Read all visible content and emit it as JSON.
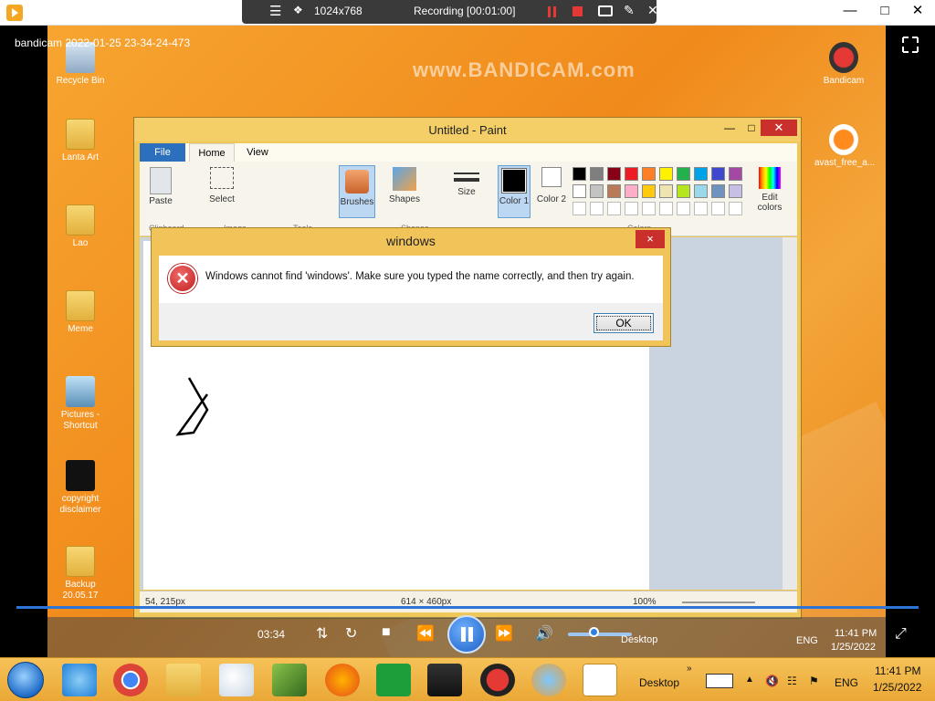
{
  "player": {
    "resolution": "1024x768",
    "recording_status": "Recording [00:01:00]",
    "video_filename": "bandicam 2022-01-25 23-34-24-473",
    "watermark": "www.BANDICAM.com",
    "current_time": "03:34",
    "playback_progress": 1.0,
    "volume_level": 0.4
  },
  "desktop": {
    "icons_left": [
      {
        "label": "Recycle Bin"
      },
      {
        "label": "Lanta Art"
      },
      {
        "label": "Lao"
      },
      {
        "label": "Meme"
      },
      {
        "label": "Pictures - Shortcut"
      },
      {
        "label": "copyright disclaimer"
      },
      {
        "label": "Backup 20.05.17"
      }
    ],
    "icons_right": [
      {
        "label": "Bandicam"
      },
      {
        "label": "avast_free_a..."
      }
    ]
  },
  "paint": {
    "title": "Untitled - Paint",
    "tabs": [
      "File",
      "Home",
      "View"
    ],
    "groups": [
      "Clipboard",
      "Image",
      "Tools",
      "Shapes",
      "Colors"
    ],
    "buttons": {
      "paste": "Paste",
      "select": "Select",
      "brushes": "Brushes",
      "shapes": "Shapes",
      "size": "Size",
      "color1": "Color 1",
      "color2": "Color 2",
      "edit_colors": "Edit colors"
    },
    "status": {
      "cursor_pos": "54, 215px",
      "canvas_size": "614 × 460px",
      "zoom": "100%"
    },
    "palette_row1": [
      "#000000",
      "#7f7f7f",
      "#880015",
      "#ed1c24",
      "#ff7f27",
      "#fff200",
      "#22b14c",
      "#00a2e8",
      "#3f48cc",
      "#a349a4"
    ],
    "palette_row2": [
      "#ffffff",
      "#c3c3c3",
      "#b97a57",
      "#ffaec9",
      "#ffc90e",
      "#efe4b0",
      "#b5e61d",
      "#99d9ea",
      "#7092be",
      "#c8bfe7"
    ]
  },
  "dialog": {
    "title": "windows",
    "message": "Windows cannot find 'windows'. Make sure you typed the name correctly, and then try again.",
    "ok_label": "OK",
    "close_glyph": "×"
  },
  "taskbar": {
    "desktop_label": "Desktop",
    "language": "ENG",
    "time": "11:41 PM",
    "date": "1/25/2022"
  },
  "ghost_taskbar": {
    "desktop_label": "Desktop",
    "language": "ENG",
    "time": "11:41 PM",
    "date": "1/25/2022"
  }
}
